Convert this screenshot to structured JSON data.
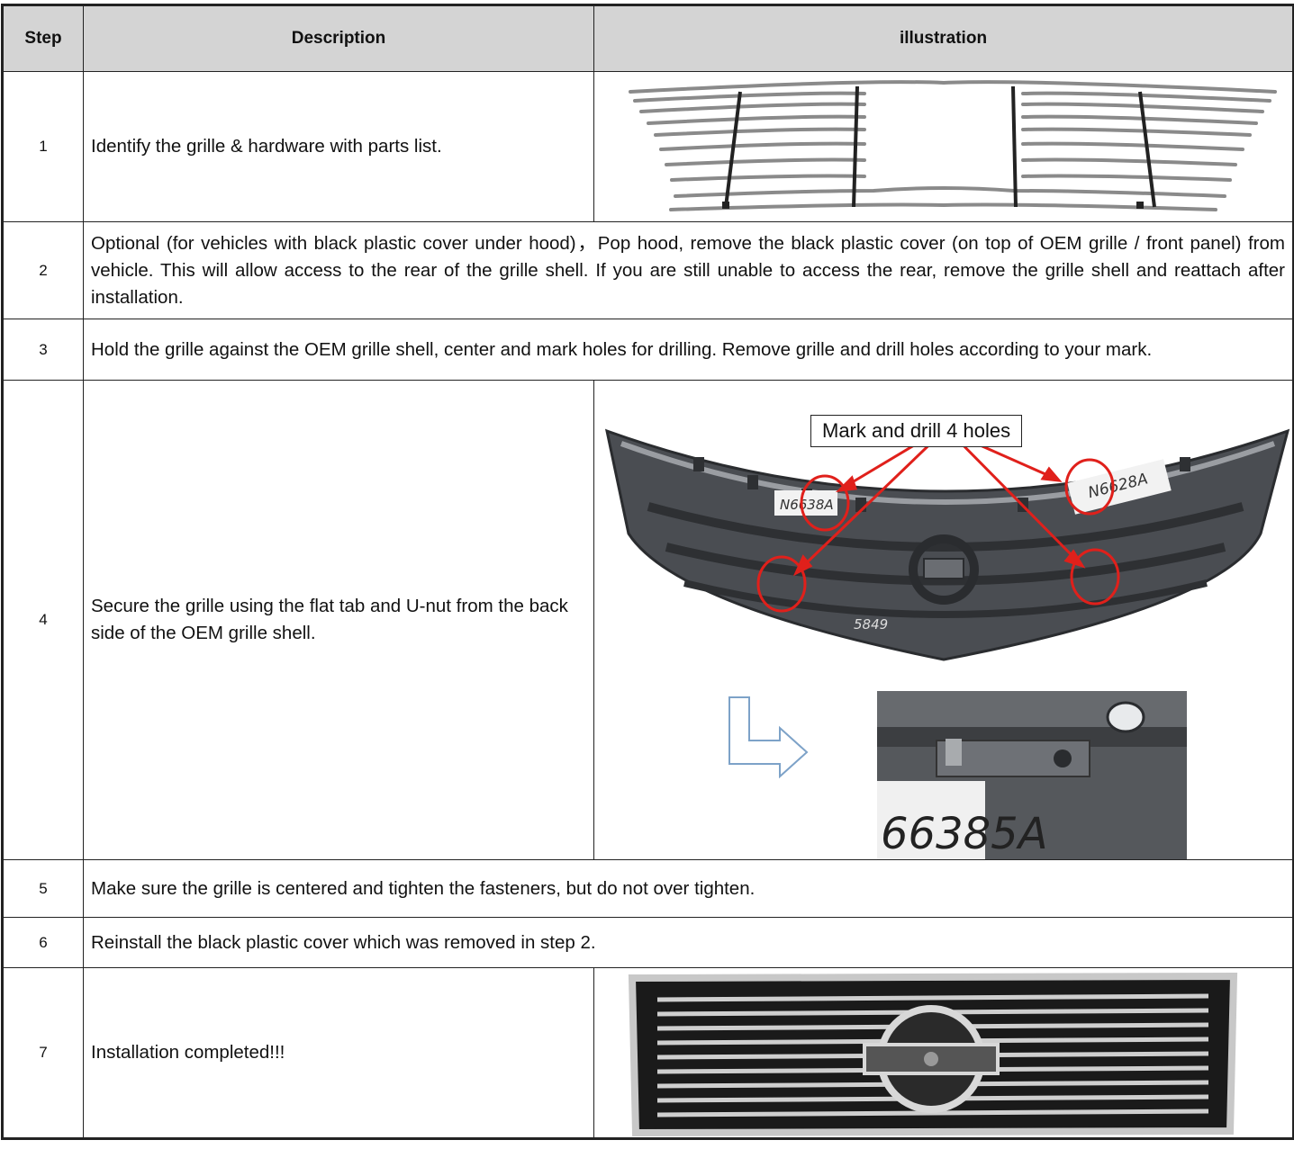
{
  "header": {
    "step": "Step",
    "description": "Description",
    "illustration": "illustration"
  },
  "rows": [
    {
      "step": "1",
      "description": "Identify the grille & hardware with parts list."
    },
    {
      "step": "2",
      "description": "Optional (for vehicles with black plastic cover under hood)，Pop hood, remove the black plastic cover (on top of OEM grille / front panel) from vehicle. This will allow access to the rear of the grille shell. If you are still unable to access the rear,  remove the grille shell and reattach after installation."
    },
    {
      "step": "3",
      "description": "Hold the grille against the OEM grille shell, center and mark holes for drilling. Remove grille and drill holes according to your mark."
    },
    {
      "step": "4",
      "description": "Secure the grille using the flat tab and U-nut from the back side of the OEM grille shell.",
      "callout": "Mark and drill 4 holes",
      "image_text": [
        "N6638A",
        "N6628A",
        "5849",
        "66385A"
      ]
    },
    {
      "step": "5",
      "description": "Make sure the grille is centered and tighten the fasteners, but do not over tighten."
    },
    {
      "step": "6",
      "description": "Reinstall the black plastic cover which was removed in step 2."
    },
    {
      "step": "7",
      "description": "Installation completed!!!"
    }
  ],
  "colors": {
    "header_bg": "#d4d4d4",
    "arrow_red": "#e0201b",
    "arrow_blue": "#7da2c8"
  }
}
